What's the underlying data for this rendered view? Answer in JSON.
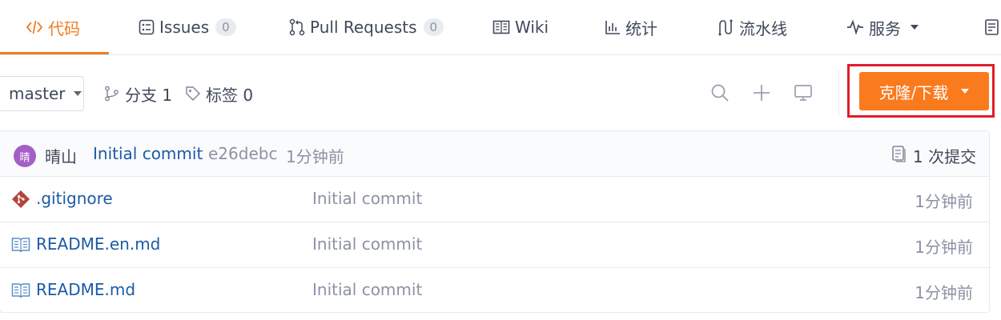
{
  "tabs": [
    {
      "label": "代码",
      "icon": "code-icon",
      "active": true
    },
    {
      "label": "Issues",
      "icon": "issues-icon",
      "count": "0"
    },
    {
      "label": "Pull Requests",
      "icon": "pull-request-icon",
      "count": "0"
    },
    {
      "label": "Wiki",
      "icon": "book-icon"
    },
    {
      "label": "统计",
      "icon": "bar-chart-icon"
    },
    {
      "label": "流水线",
      "icon": "pipeline-icon"
    },
    {
      "label": "服务",
      "icon": "pulse-icon"
    }
  ],
  "toolbar": {
    "branch": "master",
    "branches": "分支 1",
    "tags": "标签 0",
    "clone_label": "克隆/下载"
  },
  "commit": {
    "avatar_text": "晴",
    "author": "晴山",
    "message": "Initial commit",
    "hash": "e26debc",
    "time": "1分钟前",
    "count": "1 次提交"
  },
  "files": [
    {
      "name": ".gitignore",
      "icon": "git-file-icon",
      "commit": "Initial commit",
      "time": "1分钟前"
    },
    {
      "name": "README.en.md",
      "icon": "book-file-icon",
      "commit": "Initial commit",
      "time": "1分钟前"
    },
    {
      "name": "README.md",
      "icon": "book-file-icon",
      "commit": "Initial commit",
      "time": "1分钟前"
    }
  ],
  "colors": {
    "accent": "#f17c21",
    "clone_button": "#fa7a1e",
    "highlight": "#e11d2a",
    "link": "#1b5aa6"
  }
}
